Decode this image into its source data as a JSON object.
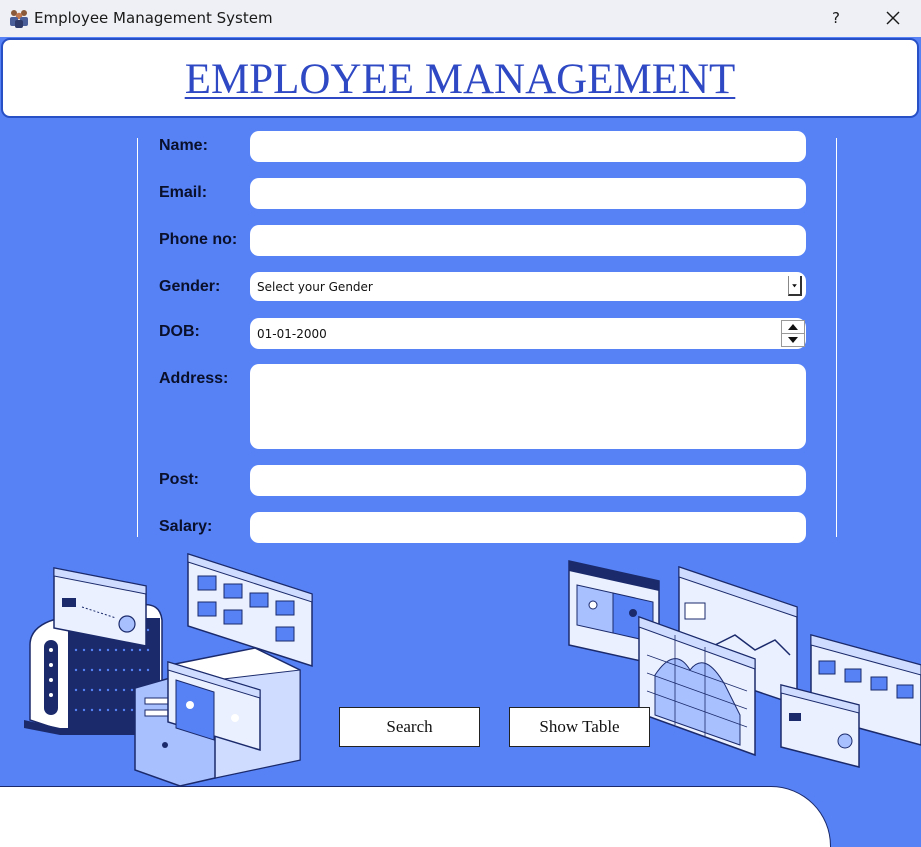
{
  "window": {
    "title": "Employee Management System",
    "help_label": "?"
  },
  "header": {
    "title": "EMPLOYEE MANAGEMENT"
  },
  "form": {
    "name_label": "Name:",
    "email_label": "Email:",
    "phone_label": "Phone no:",
    "gender_label": "Gender:",
    "gender_value": "Select your Gender",
    "dob_label": "DOB:",
    "dob_value": "01-01-2000",
    "address_label": "Address:",
    "post_label": "Post:",
    "salary_label": "Salary:"
  },
  "buttons": {
    "search": "Search",
    "show_table": "Show Table"
  },
  "colors": {
    "background": "#5682f6",
    "header_text": "#2f49c4",
    "dark_navy": "#1b2a6b"
  }
}
